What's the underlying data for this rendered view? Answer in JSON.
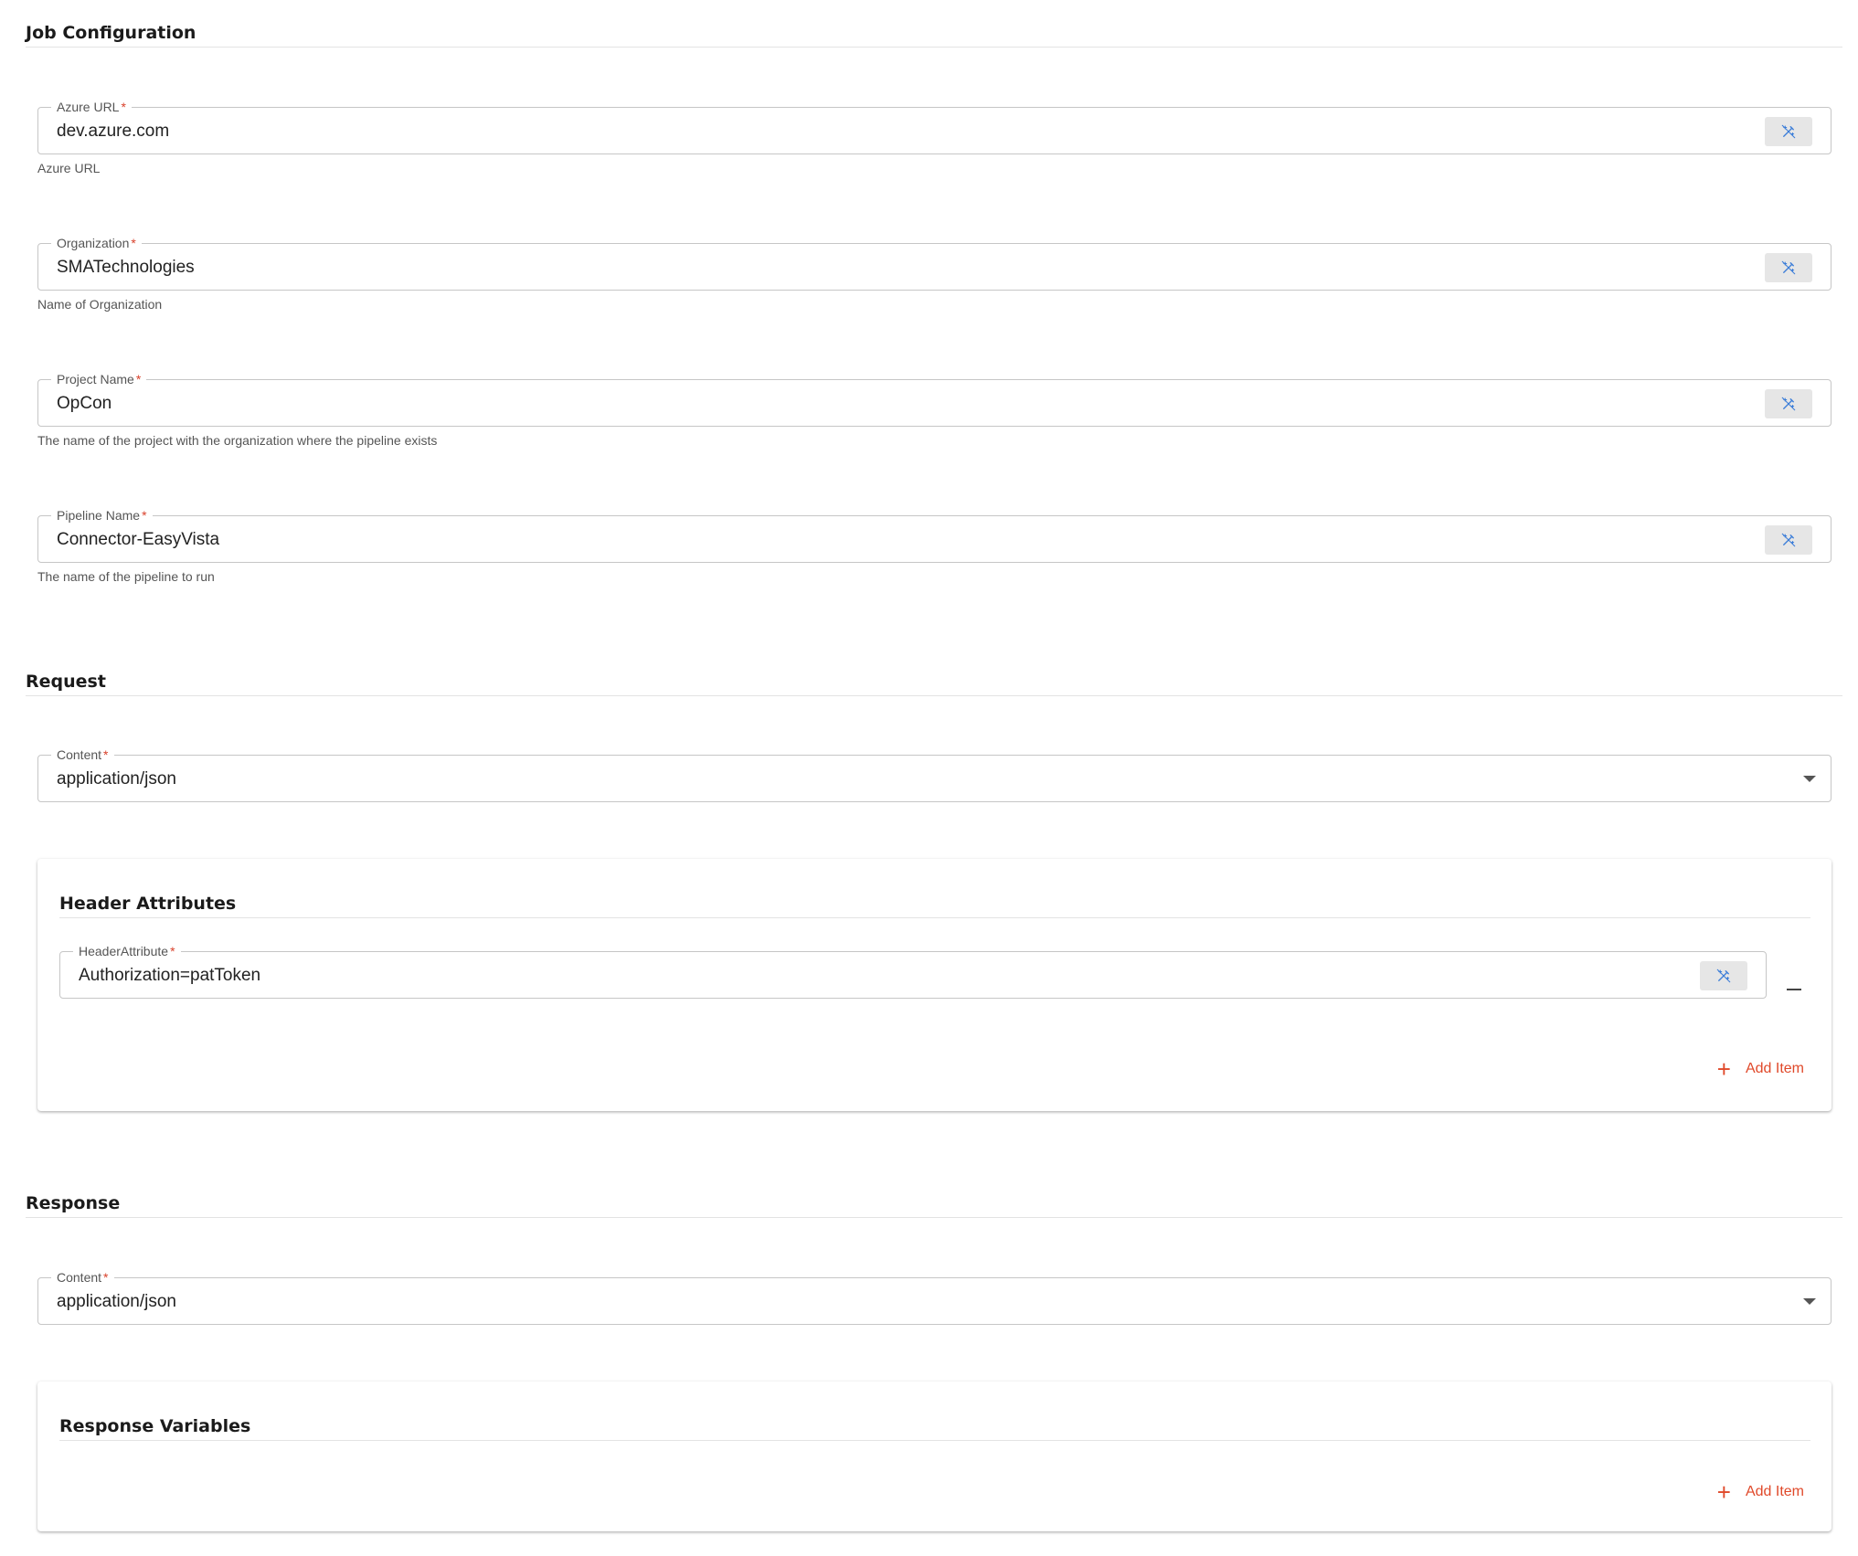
{
  "job_configuration": {
    "title": "Job Configuration",
    "azure_url": {
      "label": "Azure URL",
      "value": "dev.azure.com",
      "helper": "Azure URL"
    },
    "organization": {
      "label": "Organization",
      "value": "SMATechnologies",
      "helper": "Name of Organization"
    },
    "project_name": {
      "label": "Project Name",
      "value": "OpCon",
      "helper": "The name of the project with the organization where the pipeline exists"
    },
    "pipeline_name": {
      "label": "Pipeline Name",
      "value": "Connector-EasyVista",
      "helper": "The name of the pipeline to run"
    }
  },
  "request": {
    "title": "Request",
    "content": {
      "label": "Content",
      "value": "application/json"
    },
    "header_attributes": {
      "title": "Header Attributes",
      "items": [
        {
          "label": "HeaderAttribute",
          "value": "Authorization=patToken"
        }
      ],
      "add_label": "Add Item"
    }
  },
  "response": {
    "title": "Response",
    "content": {
      "label": "Content",
      "value": "application/json"
    },
    "response_variables": {
      "title": "Response Variables",
      "add_label": "Add Item"
    }
  },
  "required_marker": "*",
  "icons": {
    "wand": "magic-wand-icon",
    "caret": "chevron-down-icon",
    "remove": "minus-icon",
    "add": "plus-icon"
  },
  "colors": {
    "accent": "#e0492a",
    "required": "#d9412b",
    "wand": "#3b7dd8"
  }
}
